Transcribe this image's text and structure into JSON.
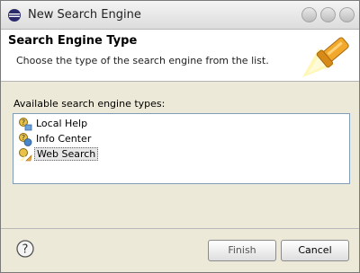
{
  "window": {
    "title": "New Search Engine"
  },
  "banner": {
    "title": "Search Engine Type",
    "description": "Choose the type of the search engine from the list."
  },
  "list": {
    "label": "Available search engine types:",
    "items": [
      {
        "label": "Local Help",
        "icon": "local-help-icon",
        "selected": false
      },
      {
        "label": "Info Center",
        "icon": "info-center-icon",
        "selected": false
      },
      {
        "label": "Web Search",
        "icon": "web-search-icon",
        "selected": true
      }
    ]
  },
  "buttons": {
    "finish": "Finish",
    "cancel": "Cancel"
  },
  "colors": {
    "list_border": "#7f9db9",
    "dialog_bg": "#ece9d8",
    "banner_bg": "#ffffff"
  }
}
